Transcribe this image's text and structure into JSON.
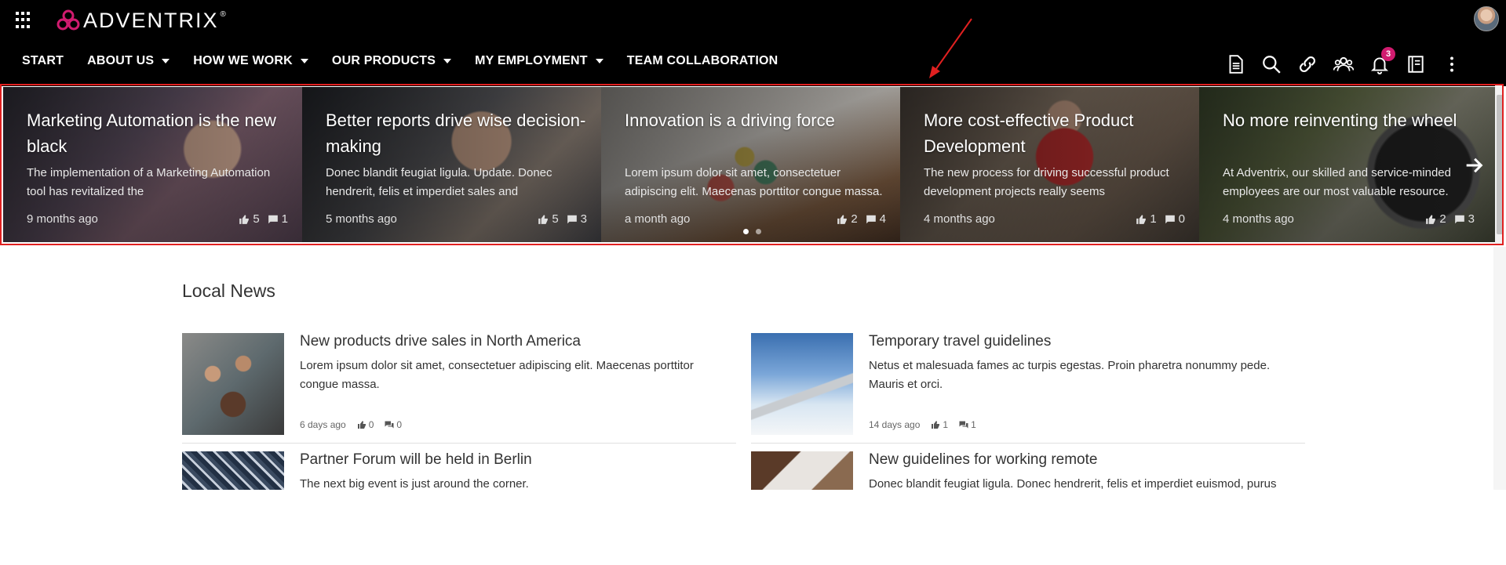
{
  "header": {
    "logo_text": "ADVENTRIX",
    "logo_sup": "®",
    "nav": [
      {
        "label": "START",
        "dropdown": false
      },
      {
        "label": "ABOUT US",
        "dropdown": true
      },
      {
        "label": "HOW WE WORK",
        "dropdown": true
      },
      {
        "label": "OUR PRODUCTS",
        "dropdown": true
      },
      {
        "label": "MY EMPLOYMENT",
        "dropdown": true
      },
      {
        "label": "TEAM COLLABORATION",
        "dropdown": false
      }
    ],
    "tools": [
      "document-icon",
      "search-icon",
      "link-icon",
      "people-icon",
      "bell-icon",
      "notebook-icon",
      "more-vertical-icon"
    ],
    "notification_count": "3"
  },
  "carousel": {
    "slides": [
      {
        "title": "Marketing Automation is the new black",
        "excerpt": "The implementation of a Marketing Automation tool has revitalized the",
        "date": "9 months ago",
        "likes": "5",
        "comments": "1"
      },
      {
        "title": "Better reports drive wise decision-making",
        "excerpt": "Donec blandit feugiat ligula. Update. Donec hendrerit, felis et imperdiet sales and",
        "date": "5 months ago",
        "likes": "5",
        "comments": "3"
      },
      {
        "title": "Innovation is a driving force",
        "excerpt": "Lorem ipsum dolor sit amet, consectetuer adipiscing elit. Maecenas porttitor congue massa.",
        "date": "a month ago",
        "likes": "2",
        "comments": "4"
      },
      {
        "title": "More cost-effective Product Development",
        "excerpt": "The new process for driving successful product development projects really seems",
        "date": "4 months ago",
        "likes": "1",
        "comments": "0"
      },
      {
        "title": "No more reinventing the wheel",
        "excerpt": "At Adventrix, our skilled and service-minded employees are our most valuable resource.",
        "date": "4 months ago",
        "likes": "2",
        "comments": "3"
      }
    ],
    "active_page": 1,
    "page_count": 2
  },
  "local_news": {
    "title": "Local News",
    "items": [
      {
        "title": "New products drive sales in North America",
        "excerpt": "Lorem ipsum dolor sit amet, consectetuer adipiscing elit. Maecenas porttitor congue massa.",
        "date": "6 days ago",
        "likes": "0",
        "comments": "0"
      },
      {
        "title": "Temporary travel guidelines",
        "excerpt": "Netus et malesuada fames ac turpis egestas. Proin pharetra nonummy pede. Mauris et orci.",
        "date": "14 days ago",
        "likes": "1",
        "comments": "1"
      },
      {
        "title": "Partner Forum will be held in Berlin",
        "excerpt": "The next big event is just around the corner.",
        "date": "",
        "likes": "",
        "comments": ""
      },
      {
        "title": "New guidelines for working remote",
        "excerpt": "Donec blandit feugiat ligula. Donec hendrerit, felis et imperdiet euismod, purus",
        "date": "",
        "likes": "",
        "comments": ""
      }
    ]
  },
  "colors": {
    "header_bg": "#000000",
    "badge": "#d11b6f",
    "carousel_border": "#e02020",
    "logo_mark": "#d11b6f"
  }
}
